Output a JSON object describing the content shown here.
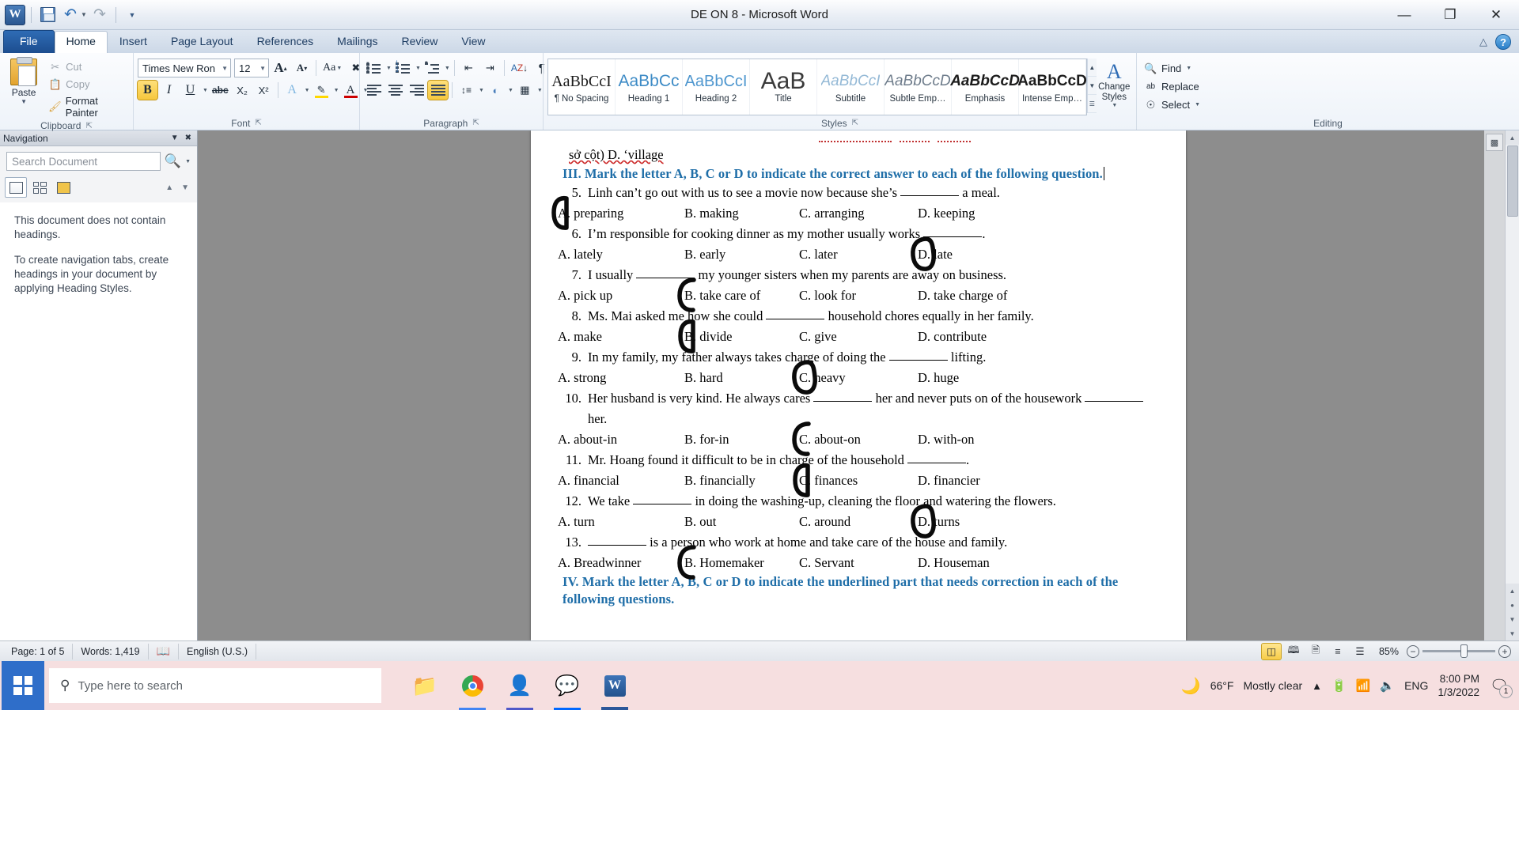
{
  "window": {
    "title": "DE ON 8  -  Microsoft Word",
    "app_logo": "W",
    "minimize": "—",
    "restore": "❐",
    "close": "✕"
  },
  "quick_access": {
    "save": "save-icon",
    "undo": "undo-icon",
    "redo": "redo-icon",
    "customize": "customize-qat-icon"
  },
  "tabs": [
    {
      "label": "File",
      "active": false,
      "file": true
    },
    {
      "label": "Home",
      "active": true
    },
    {
      "label": "Insert",
      "active": false
    },
    {
      "label": "Page Layout",
      "active": false
    },
    {
      "label": "References",
      "active": false
    },
    {
      "label": "Mailings",
      "active": false
    },
    {
      "label": "Review",
      "active": false
    },
    {
      "label": "View",
      "active": false
    }
  ],
  "ribbon": {
    "clipboard": {
      "label": "Clipboard",
      "paste": "Paste",
      "cut": "Cut",
      "copy": "Copy",
      "format_painter": "Format Painter"
    },
    "font": {
      "label": "Font",
      "font_name": "Times New Ron",
      "font_size": "12",
      "grow": "A",
      "shrink": "A",
      "change_case": "Aa",
      "clear_formatting": "A⃠",
      "bold": "B",
      "italic": "I",
      "underline": "U",
      "strikethrough": "abc",
      "subscript": "X₂",
      "superscript": "X²",
      "text_effects": "A",
      "highlight": "ab",
      "font_color": "A"
    },
    "paragraph": {
      "label": "Paragraph",
      "bullets": "bullet-list-icon",
      "numbering": "numbered-list-icon",
      "multilevel": "multilevel-list-icon",
      "decrease_indent": "decrease-indent-icon",
      "increase_indent": "increase-indent-icon",
      "sort": "sort-icon",
      "show_marks": "¶",
      "align_left": "align-left-icon",
      "align_center": "align-center-icon",
      "align_right": "align-right-icon",
      "justify": "justify-icon",
      "line_spacing": "line-spacing-icon",
      "shading": "shading-icon",
      "borders": "borders-icon"
    },
    "styles": {
      "label": "Styles",
      "items": [
        {
          "preview": "AaBbCcI",
          "name": "¶ No Spacing",
          "color": "#1c1c1c",
          "size": "20px",
          "weight": "normal",
          "family": "serif"
        },
        {
          "preview": "AaBbCc",
          "name": "Heading 1",
          "color": "#3d8bc6",
          "size": "21px",
          "weight": "normal",
          "family": "sans"
        },
        {
          "preview": "AaBbCcI",
          "name": "Heading 2",
          "color": "#4f97cf",
          "size": "20px",
          "weight": "normal",
          "family": "sans"
        },
        {
          "preview": "AaB",
          "name": "Title",
          "color": "#3a3a3a",
          "size": "30px",
          "weight": "normal",
          "family": "sans"
        },
        {
          "preview": "AaBbCcI",
          "name": "Subtitle",
          "color": "#94b9d6",
          "size": "19px",
          "weight": "normal",
          "family": "italic"
        },
        {
          "preview": "AaBbCcD",
          "name": "Subtle Emp…",
          "color": "#6f7d8c",
          "size": "19px",
          "weight": "normal",
          "family": "italic"
        },
        {
          "preview": "AaBbCcD",
          "name": "Emphasis",
          "color": "#1c1c1c",
          "size": "19px",
          "weight": "bold",
          "family": "italic"
        },
        {
          "preview": "AaBbCcD",
          "name": "Intense Emp…",
          "color": "#1c1c1c",
          "size": "19px",
          "weight": "bold",
          "family": "sans"
        }
      ],
      "change_styles": "Change Styles"
    },
    "editing": {
      "label": "Editing",
      "find": "Find",
      "replace": "Replace",
      "select": "Select"
    }
  },
  "navigation": {
    "title": "Navigation",
    "search_placeholder": "Search Document",
    "search_value": "",
    "tabs": [
      "headings-tab",
      "pages-tab",
      "results-tab"
    ],
    "selected_tab": 0,
    "empty_line1": "This document does not contain headings.",
    "empty_line2": "To create navigation tabs, create headings in your document by applying Heading Styles."
  },
  "document": {
    "prev_line": "sở cột) D. ‘village",
    "section3": "III. Mark the letter A, B, C or D to indicate the correct answer to each of the following question.",
    "section4": "IV. Mark the letter A, B, C or D to indicate the underlined part that needs correction in each of the following questions.",
    "questions": [
      {
        "num": "5.",
        "text_before": "Linh can’t go out with us to see a movie now because she’s ",
        "text_after": " a meal.",
        "options": [
          "A. preparing",
          "B. making",
          "C. arranging",
          "D. keeping"
        ],
        "circled": 0
      },
      {
        "num": "6.",
        "text_before": "I’m responsible for cooking dinner as my mother usually works ",
        "text_after": ".",
        "options": [
          "A. lately",
          "B. early",
          "C. later",
          "D. late"
        ],
        "circled": 3
      },
      {
        "num": "7.",
        "text_before": "I usually ",
        "text_after": " my younger sisters when my parents are away on business.",
        "options": [
          "A. pick up",
          "B. take care of",
          "C. look for",
          "D. take charge of"
        ],
        "circled": 1
      },
      {
        "num": "8.",
        "text_before": "Ms. Mai asked me how she could ",
        "text_after": " household chores equally in her family.",
        "options": [
          "A. make",
          "B. divide",
          "C. give",
          "D. contribute"
        ],
        "circled": 1
      },
      {
        "num": "9.",
        "text_before": "In my family, my father always takes charge of doing the ",
        "text_after": " lifting.",
        "options": [
          "A. strong",
          "B. hard",
          "C. heavy",
          "D. huge"
        ],
        "circled": 2
      },
      {
        "num": "10.",
        "text_before": "Her husband is very kind. He always cares ",
        "text_after": " her and never puts on of the housework ",
        "text_after2": " her.",
        "options": [
          "A. about-in",
          "B. for-in",
          "C. about-on",
          "D. with-on"
        ],
        "circled": 2
      },
      {
        "num": "11.",
        "text_before": "Mr. Hoang found it difficult to be in charge of the household ",
        "text_after": ".",
        "options": [
          "A. financial",
          "B. financially",
          "C. finances",
          "D. financier"
        ],
        "circled": 2
      },
      {
        "num": "12.",
        "text_before": "We take ",
        "text_after": " in doing the washing-up, cleaning the floor and watering the flowers.",
        "options": [
          "A. turn",
          "B. out",
          "C. around",
          "D. turns"
        ],
        "circled": 3
      },
      {
        "num": "13.",
        "text_before": "",
        "text_after": " is a person who work at home and take care of the house and family.",
        "options": [
          "A. Breadwinner",
          "B. Homemaker",
          "C. Servant",
          "D. Houseman"
        ],
        "circled": 1
      }
    ]
  },
  "status_bar": {
    "page": "Page: 1 of 5",
    "words": "Words: 1,419",
    "proofing": "proofing-errors-icon",
    "language": "English (U.S.)",
    "views": [
      "print-layout-view",
      "full-screen-reading-view",
      "web-layout-view",
      "outline-view",
      "draft-view"
    ],
    "selected_view": 0,
    "zoom": "85%",
    "zoom_out": "−",
    "zoom_in": "+"
  },
  "taskbar": {
    "start": "start-button",
    "search_placeholder": "Type here to search",
    "apps": [
      "file-explorer",
      "google-chrome",
      "microsoft-teams",
      "zalo",
      "microsoft-word"
    ],
    "weather_temp": "66°F",
    "weather_desc": "Mostly clear",
    "language": "ENG",
    "time": "8:00 PM",
    "date": "1/3/2022",
    "notification_count": "1"
  },
  "colors": {
    "accent": "#2f6cb5",
    "section_heading": "#1f6ea8",
    "highlight": "#f6c73d",
    "taskbar_bg": "#f6dfe0"
  }
}
